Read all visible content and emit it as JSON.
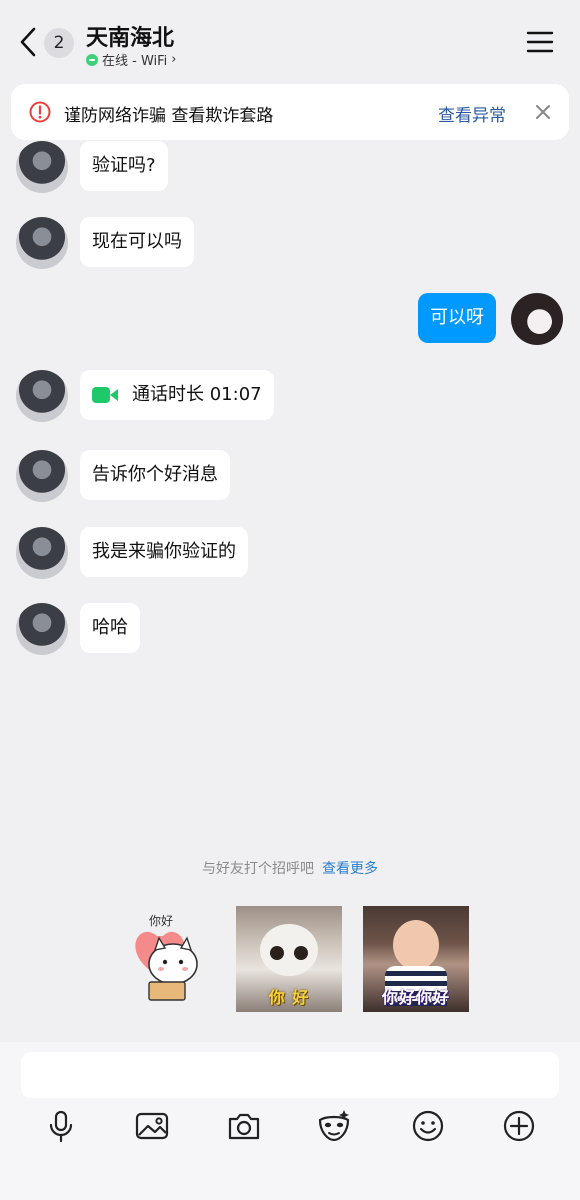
{
  "header": {
    "unread_count": "2",
    "contact_name": "天南海北",
    "status": "在线 - WiFi"
  },
  "banner": {
    "text": "谨防网络诈骗 查看欺诈套路",
    "link": "查看异常"
  },
  "messages": [
    {
      "side": "peer",
      "text": "验证吗?"
    },
    {
      "side": "peer",
      "text": "现在可以吗"
    },
    {
      "side": "self",
      "text": "可以呀"
    },
    {
      "side": "peer",
      "type": "call",
      "text": "通话时长 01:07"
    },
    {
      "side": "peer",
      "text": "告诉你个好消息"
    },
    {
      "side": "peer",
      "text": "我是来骗你验证的"
    },
    {
      "side": "peer",
      "text": "哈哈"
    }
  ],
  "greeting": {
    "hint": "与好友打个招呼吧",
    "more_link": "查看更多",
    "stickers": [
      {
        "caption": "你好"
      },
      {
        "caption": "你 好"
      },
      {
        "caption": "你好你好"
      }
    ]
  },
  "composer": {
    "input_value": "",
    "toolbar": [
      "microphone-icon",
      "image-icon",
      "camera-icon",
      "mask-icon",
      "emoji-icon",
      "plus-icon"
    ]
  },
  "colors": {
    "accent": "#0099ff",
    "call_green": "#1fc96a",
    "warning_red": "#e8413a",
    "link_blue": "#2a5aa0"
  }
}
